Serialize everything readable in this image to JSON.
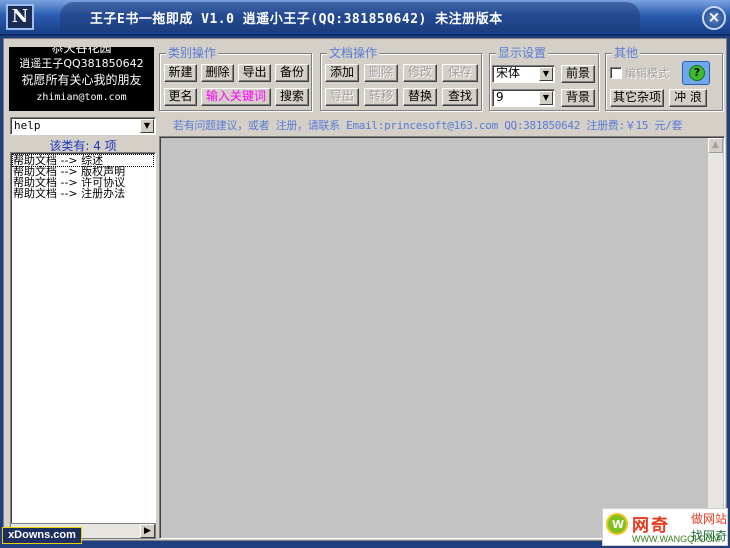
{
  "window": {
    "title": "王子E书一拖即成 V1.0 逍遥小王子(QQ:381850642) 未注册版本",
    "icon_label": "N",
    "close_glyph": "×"
  },
  "logo": {
    "line1": "恭天谷花园",
    "line2": "逍遥王子QQ381850642",
    "line3": "祝愿所有关心我的朋友",
    "line4": "zhimian@tom.com"
  },
  "category_ops": {
    "title": "类别操作",
    "new": "新建",
    "delete": "删除",
    "export": "导出",
    "backup": "备份",
    "rename": "更名",
    "keyword": "输入关键词",
    "search": "搜索"
  },
  "document_ops": {
    "title": "文档操作",
    "add": "添加",
    "delete": "删除",
    "modify": "修改",
    "save": "保存",
    "export": "导出",
    "convert": "转移",
    "replace": "替换",
    "find": "查找"
  },
  "display": {
    "title": "显示设置",
    "font_value": "宋体",
    "size_value": "9",
    "foreground": "前景",
    "background": "背景"
  },
  "other": {
    "title": "其他",
    "checkbox_label": "编辑模式",
    "help_glyph": "?",
    "misc": "其它杂项",
    "surf": "冲 浪"
  },
  "sidebar": {
    "category_value": "help",
    "count_text": "该类有: 4 项",
    "items": [
      "帮助文档 --> 综述",
      "帮助文档 --> 版权声明",
      "帮助文档 --> 许可协议",
      "帮助文档 --> 注册办法"
    ]
  },
  "notice": "若有问题建议，或者 注册，请联系 Email:princesoft@163.com  QQ:381850642  注册费:￥15 元/套",
  "watermarks": {
    "left": "xDowns.com",
    "right_big": "网奇",
    "right_small": "WWW.WANGQI.COM",
    "right_side1": "做网站",
    "right_side2": "找网奇"
  },
  "colors": {
    "title_bar": "#2a5cb0",
    "group_title": "#5a7cd6",
    "keyword_text": "#ff00ff",
    "count_text": "#1a38c0"
  }
}
